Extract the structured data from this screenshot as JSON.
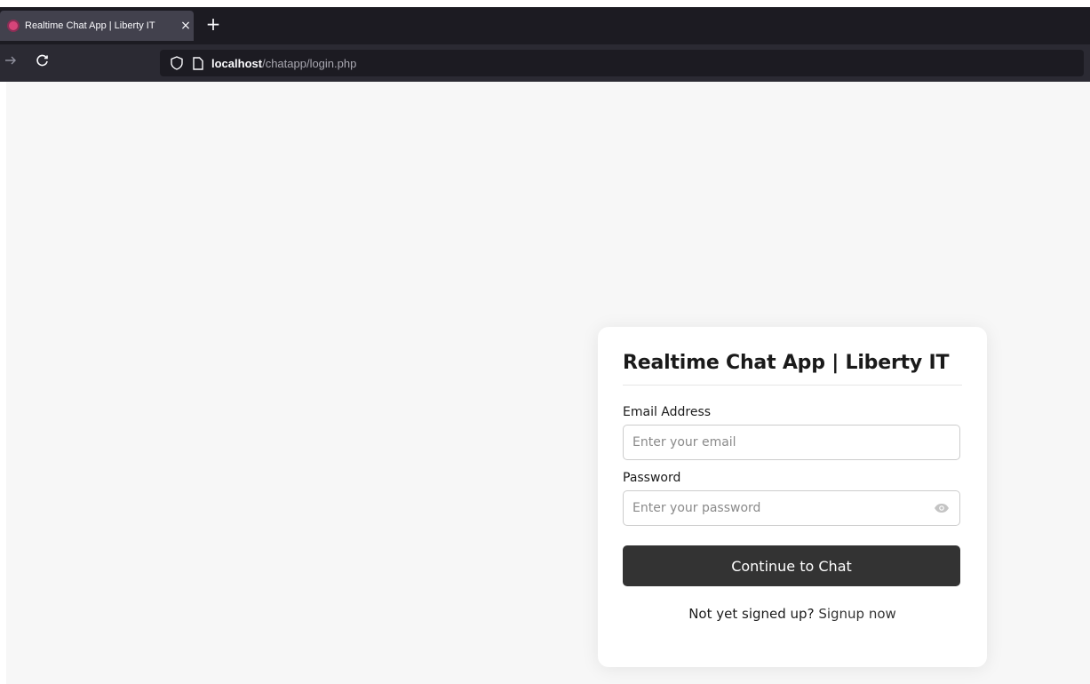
{
  "browser": {
    "tab_title": "Realtime Chat App | Liberty IT",
    "tab_close": "×",
    "new_tab": "+",
    "url_host": "localhost",
    "url_path": "/chatapp/login.php"
  },
  "card": {
    "title": "Realtime Chat App | Liberty IT",
    "email_label": "Email Address",
    "email_placeholder": "Enter your email",
    "password_label": "Password",
    "password_placeholder": "Enter your password",
    "submit_label": "Continue to Chat",
    "signup_prompt": "Not yet signed up?",
    "signup_link": "Signup now"
  },
  "colors": {
    "tabstrip_bg": "#1c1b22",
    "navbar_bg": "#2b2a33",
    "page_bg": "#f7f7f7",
    "button_bg": "#333333"
  }
}
